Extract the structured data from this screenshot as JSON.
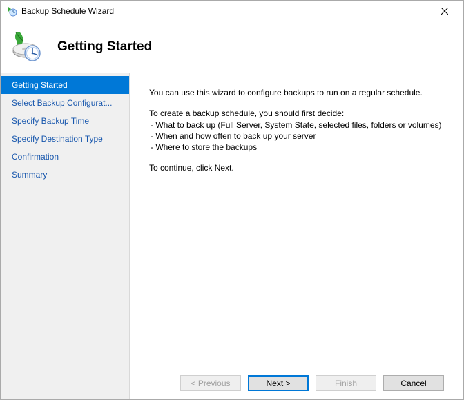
{
  "window": {
    "title": "Backup Schedule Wizard"
  },
  "header": {
    "title": "Getting Started"
  },
  "sidebar": {
    "items": [
      {
        "label": "Getting Started",
        "selected": true
      },
      {
        "label": "Select Backup Configurat...",
        "selected": false
      },
      {
        "label": "Specify Backup Time",
        "selected": false
      },
      {
        "label": "Specify Destination Type",
        "selected": false
      },
      {
        "label": "Confirmation",
        "selected": false
      },
      {
        "label": "Summary",
        "selected": false
      }
    ]
  },
  "content": {
    "intro": "You can use this wizard to configure backups to run on a regular schedule.",
    "decide_label": "To create a backup schedule, you should first decide:",
    "bullets": [
      "-   What to back up (Full Server, System State, selected files, folders or volumes)",
      "-   When and how often to back up your server",
      "-   Where to store the backups"
    ],
    "continue": "To continue, click Next."
  },
  "buttons": {
    "previous": "< Previous",
    "next": "Next >",
    "finish": "Finish",
    "cancel": "Cancel"
  }
}
